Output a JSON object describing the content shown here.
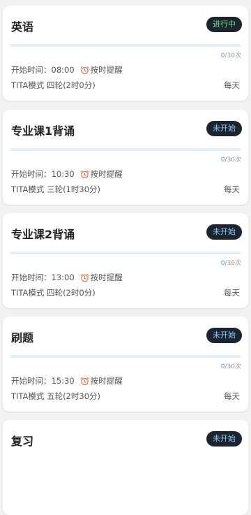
{
  "tasks": [
    {
      "title": "英语",
      "status": "进行中",
      "status_color": "#6cdf8c",
      "progress_done": "0",
      "progress_total": "/30次",
      "progress_fraction": 0,
      "start_label": "开始时间：",
      "start_time": "08:00",
      "remind_label": "按时提醒",
      "mode": "TITA模式 四轮(2时0分)",
      "frequency": "每天"
    },
    {
      "title": "专业课1背诵",
      "status": "未开始",
      "status_color": "#8ec6ff",
      "progress_done": "0",
      "progress_total": "/30次",
      "progress_fraction": 0,
      "start_label": "开始时间：",
      "start_time": "10:30",
      "remind_label": "按时提醒",
      "mode": "TITA模式 三轮(1时30分)",
      "frequency": "每天"
    },
    {
      "title": "专业课2背诵",
      "status": "未开始",
      "status_color": "#8ec6ff",
      "progress_done": "0",
      "progress_total": "/30次",
      "progress_fraction": 0,
      "start_label": "开始时间：",
      "start_time": "13:00",
      "remind_label": "按时提醒",
      "mode": "TITA模式 四轮(2时0分)",
      "frequency": "每天"
    },
    {
      "title": "刷题",
      "status": "未开始",
      "status_color": "#8ec6ff",
      "progress_done": "0",
      "progress_total": "/30次",
      "progress_fraction": 0,
      "start_label": "开始时间：",
      "start_time": "15:30",
      "remind_label": "按时提醒",
      "mode": "TITA模式 五轮(2时30分)",
      "frequency": "每天"
    },
    {
      "title": "复习",
      "status": "未开始",
      "status_color": "#8ec6ff"
    }
  ],
  "colors": {
    "alarm_icon": "#e8734a",
    "progress_done_text": "#4a90d9"
  },
  "icons": {
    "alarm": "alarm-clock-icon"
  }
}
